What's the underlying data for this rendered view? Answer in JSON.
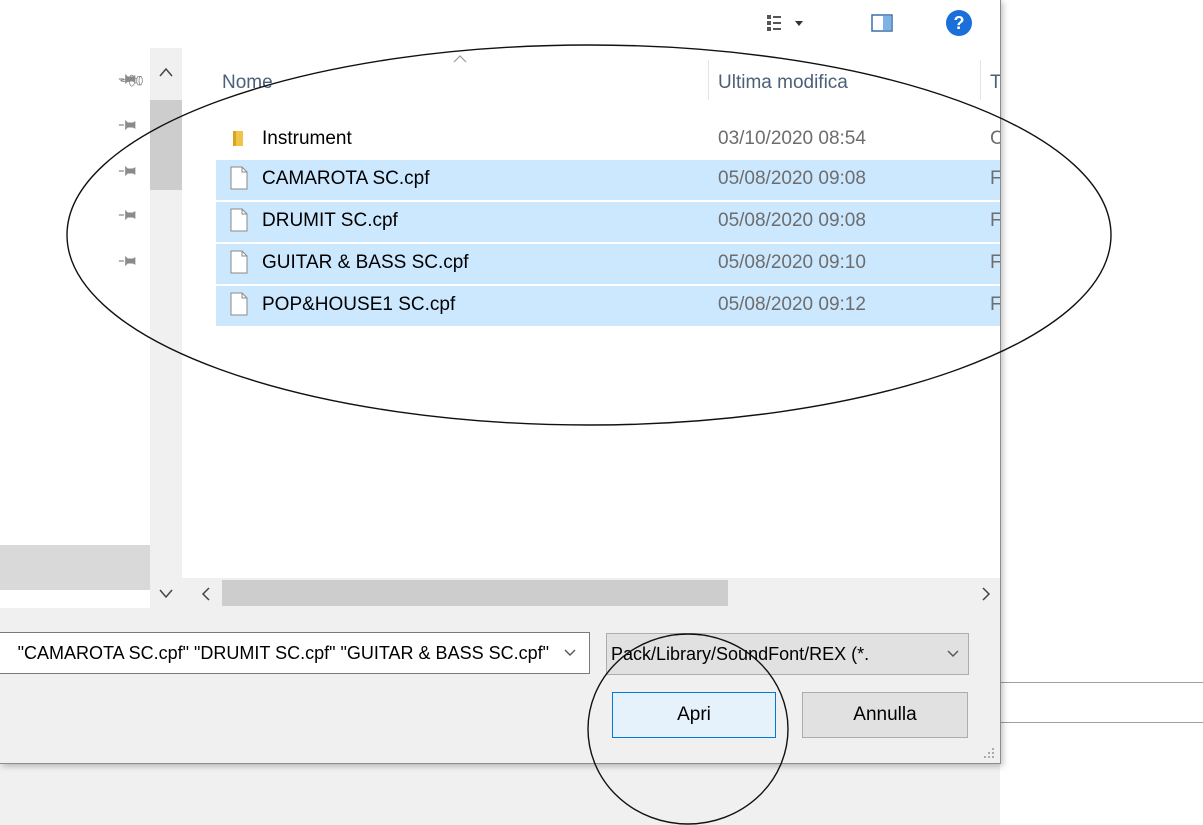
{
  "columns": {
    "name": "Nome",
    "modified": "Ultima modifica",
    "type": "T"
  },
  "files": [
    {
      "name": "Instrument",
      "modified": "03/10/2020 08:54",
      "type": "C",
      "kind": "folder",
      "selected": false
    },
    {
      "name": "CAMAROTA SC.cpf",
      "modified": "05/08/2020 09:08",
      "type": "F",
      "kind": "file",
      "selected": true
    },
    {
      "name": "DRUMIT SC.cpf",
      "modified": "05/08/2020 09:08",
      "type": "F",
      "kind": "file",
      "selected": true
    },
    {
      "name": "GUITAR & BASS SC.cpf",
      "modified": "05/08/2020 09:10",
      "type": "F",
      "kind": "file",
      "selected": true
    },
    {
      "name": "POP&HOUSE1 SC.cpf",
      "modified": "05/08/2020 09:12",
      "type": "F",
      "kind": "file",
      "selected": true
    }
  ],
  "filename_field": {
    "value": "\"CAMAROTA SC.cpf\" \"DRUMIT SC.cpf\" \"GUITAR & BASS SC.cpf\""
  },
  "filetype_field": {
    "value": "Pack/Library/SoundFont/REX (*."
  },
  "buttons": {
    "open": "Apri",
    "cancel": "Annulla"
  },
  "toolbar": {
    "help_glyph": "?"
  },
  "icons": {
    "view": "view-options-icon",
    "preview": "preview-pane-icon",
    "help": "help-icon",
    "pin": "pin-icon",
    "folder": "folder-icon",
    "file": "file-icon"
  },
  "colors": {
    "selection": "#cce8ff",
    "accent": "#0078d7",
    "help_blue": "#1a6fd9",
    "folder": "#f0c34a"
  }
}
